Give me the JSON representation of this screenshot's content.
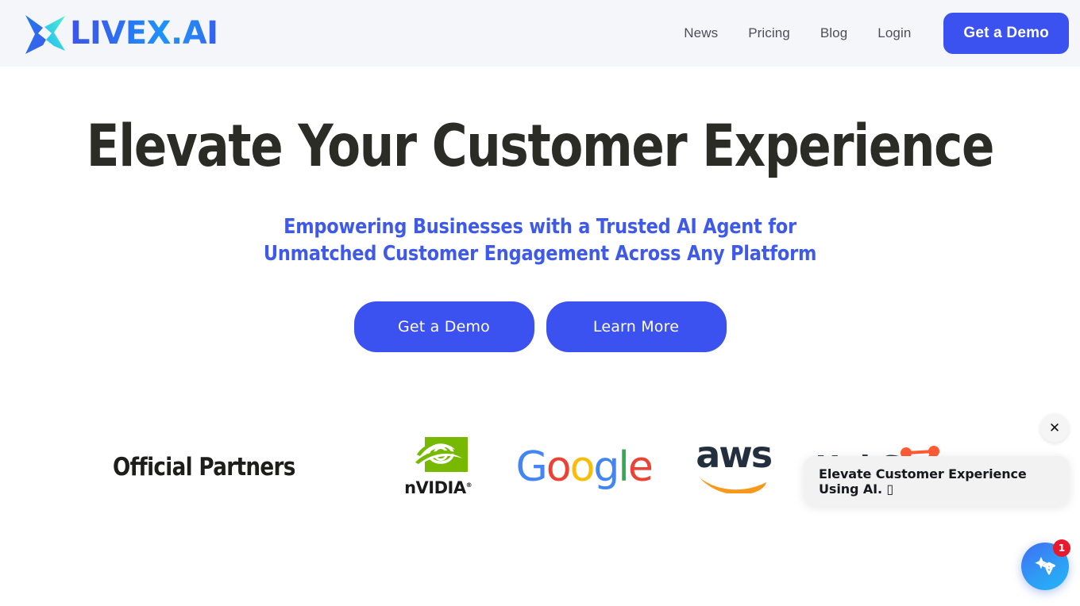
{
  "brand": {
    "name": "LIVEX.AI",
    "logo_icon": "livex-x-mark"
  },
  "nav": {
    "links": [
      {
        "label": "News"
      },
      {
        "label": "Pricing"
      },
      {
        "label": "Blog"
      },
      {
        "label": "Login"
      }
    ],
    "cta_label": "Get a Demo"
  },
  "hero": {
    "title": "Elevate Your Customer Experience",
    "subtitle": "Empowering Businesses with a Trusted AI Agent  for\nUnmatched Customer Engagement Across Any Platform",
    "primary_button": "Get a Demo",
    "secondary_button": "Learn More"
  },
  "partners": {
    "label": "Official Partners",
    "logos": [
      {
        "name": "NVIDIA",
        "wordmark": "nVIDIA",
        "trademark": "®"
      },
      {
        "name": "Google",
        "letters": [
          "G",
          "o",
          "o",
          "g",
          "l",
          "e"
        ]
      },
      {
        "name": "aws",
        "wordmark": "aws"
      },
      {
        "name": "HubSpot",
        "wordmark": "HubSpot"
      }
    ]
  },
  "chat_widget": {
    "close_label": "✕",
    "message": "Elevate Customer Experience Using AI. ▯",
    "badge_count": "1",
    "launcher_icon": "sparkle-icon"
  },
  "colors": {
    "accent_blue": "#3b52f0",
    "subtitle_blue": "#3f5ae8",
    "header_bg": "#f4f6fa",
    "headline": "#2c2c27",
    "badge_red": "#e8192c"
  }
}
